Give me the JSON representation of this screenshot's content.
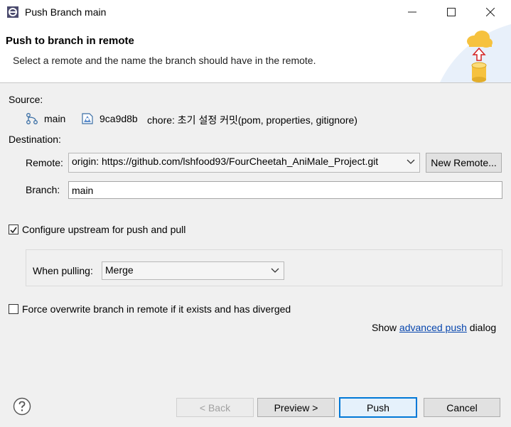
{
  "window": {
    "title": "Push Branch main"
  },
  "header": {
    "title": "Push to branch in remote",
    "description": "Select a remote and the name the branch should have in the remote."
  },
  "source": {
    "label": "Source:",
    "branch": "main",
    "commit_id": "9ca9d8b",
    "commit_message": "chore: 초기 설정 커밋(pom, properties, gitignore)"
  },
  "destination": {
    "label": "Destination:",
    "remote_label": "Remote:",
    "remote_value": "origin: https://github.com/lshfood93/FourCheetah_AniMale_Project.git",
    "new_remote_label": "New Remote...",
    "branch_label": "Branch:",
    "branch_value": "main"
  },
  "upstream": {
    "configure_label": "Configure upstream for push and pull",
    "configure_checked": true,
    "when_pulling_label": "When pulling:",
    "when_pulling_value": "Merge"
  },
  "force": {
    "label": "Force overwrite branch in remote if it exists and has diverged",
    "checked": false
  },
  "advanced": {
    "prefix": "Show",
    "link": "advanced push",
    "suffix": "dialog"
  },
  "buttons": {
    "back": "< Back",
    "preview": "Preview >",
    "push": "Push",
    "cancel": "Cancel"
  }
}
